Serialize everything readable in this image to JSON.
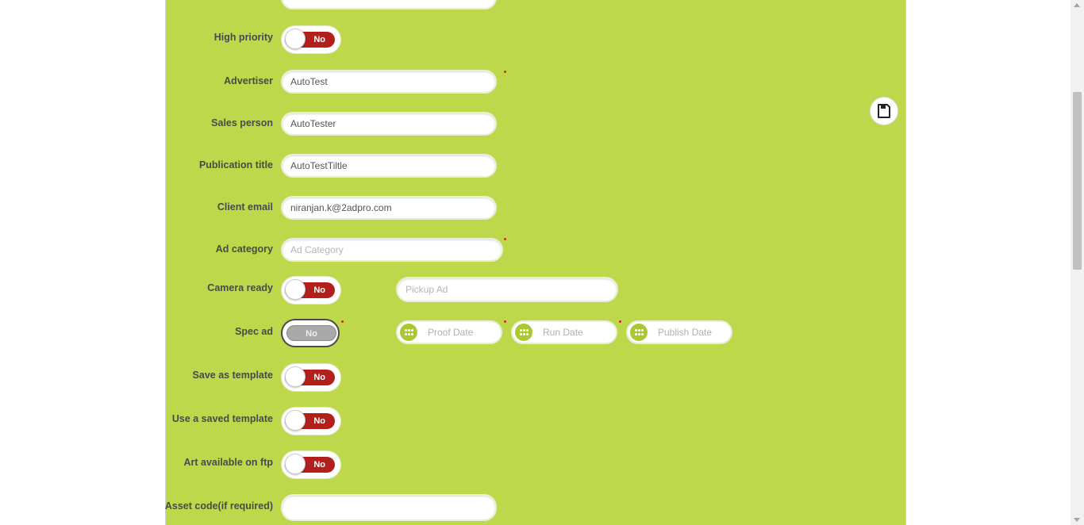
{
  "form": {
    "high_priority": {
      "label": "High priority",
      "toggle": "No"
    },
    "advertiser": {
      "label": "Advertiser",
      "value": "AutoTest"
    },
    "sales_person": {
      "label": "Sales person",
      "value": "AutoTester"
    },
    "publication_title": {
      "label": "Publication title",
      "value": "AutoTestTiltle"
    },
    "client_email": {
      "label": "Client email",
      "value": "niranjan.k@2adpro.com"
    },
    "ad_category": {
      "label": "Ad category",
      "placeholder": "Ad Category"
    },
    "camera_ready": {
      "label": "Camera ready",
      "toggle": "No",
      "pickup_placeholder": "Pickup Ad"
    },
    "spec_ad": {
      "label": "Spec ad",
      "toggle": "No"
    },
    "dates": {
      "proof": "Proof Date",
      "run": "Run Date",
      "publish": "Publish Date"
    },
    "save_as_template": {
      "label": "Save as template",
      "toggle": "No"
    },
    "use_saved_template": {
      "label": "Use a saved template",
      "toggle": "No"
    },
    "art_on_ftp": {
      "label": "Art available on ftp",
      "toggle": "No"
    },
    "asset_code": {
      "label": "Asset code(if required)",
      "value": ""
    }
  },
  "icons": {
    "save": "save-icon",
    "calendar": "calendar-icon"
  },
  "colors": {
    "panel": "#bdd84a",
    "toggle_no": "#b3201c",
    "calendar": "#a9c832"
  }
}
